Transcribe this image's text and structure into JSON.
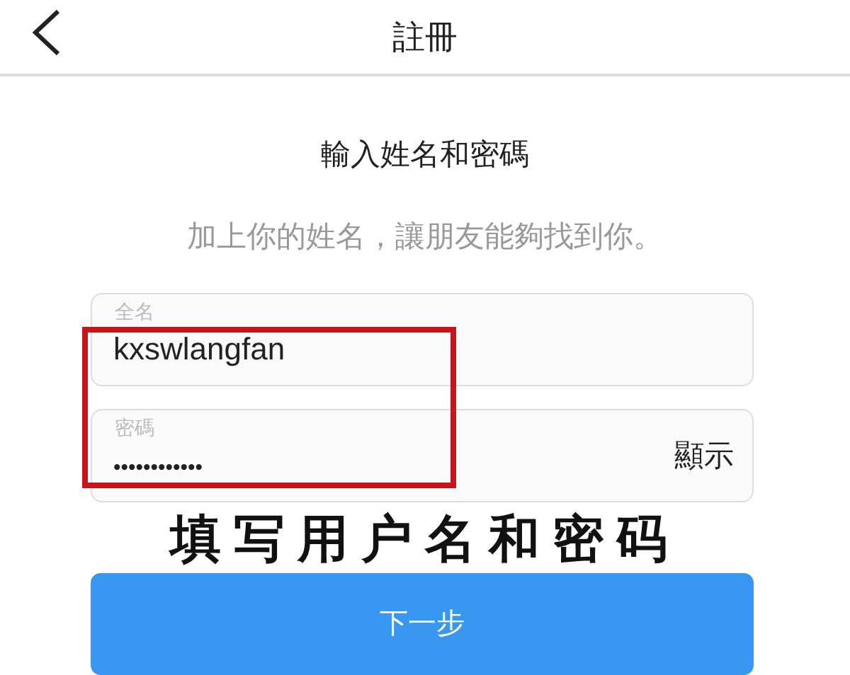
{
  "header": {
    "title": "註冊"
  },
  "heading": "輸入姓名和密碼",
  "subtitle": "加上你的姓名，讓朋友能夠找到你。",
  "fields": [
    {
      "label": "全名",
      "value": "kxswlangfan"
    },
    {
      "label": "密碼",
      "value": "••••••••••••",
      "toggle": "顯示"
    }
  ],
  "annotation": {
    "caption": "填写用户名和密码",
    "highlight": true
  },
  "buttons": [
    "下一步"
  ]
}
